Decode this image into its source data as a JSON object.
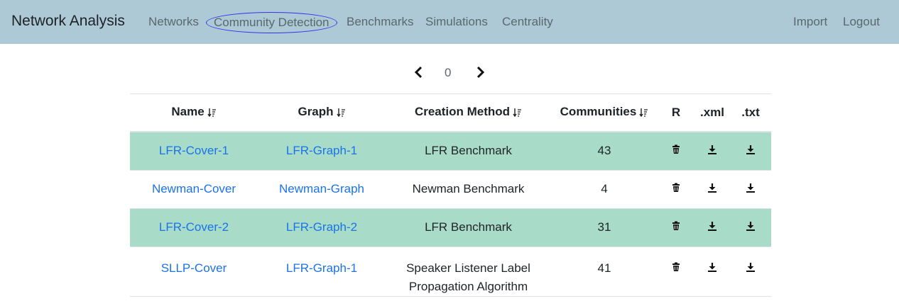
{
  "nav": {
    "brand": "Network Analysis",
    "links": [
      "Networks",
      "Community Detection",
      "Benchmarks",
      "Simulations",
      "Centrality"
    ],
    "right_links": [
      "Import",
      "Logout"
    ]
  },
  "pager": {
    "page": "0"
  },
  "table": {
    "headers": [
      "Name",
      "Graph",
      "Creation Method",
      "Communities",
      "R",
      ".xml",
      ".txt"
    ],
    "rows": [
      {
        "name": "LFR-Cover-1",
        "graph": "LFR-Graph-1",
        "method": "LFR Benchmark",
        "communities": "43"
      },
      {
        "name": "Newman-Cover",
        "graph": "Newman-Graph",
        "method": "Newman Benchmark",
        "communities": "4"
      },
      {
        "name": "LFR-Cover-2",
        "graph": "LFR-Graph-2",
        "method": "LFR Benchmark",
        "communities": "31"
      },
      {
        "name": "SLLP-Cover",
        "graph": "LFR-Graph-1",
        "method_line1": "Speaker Listener Label",
        "method_line2": "Propagation Algorithm",
        "communities": "41"
      }
    ]
  },
  "icons": {
    "sort": "sort-desc-icon",
    "delete": "trash-icon",
    "download": "download-icon",
    "prev": "chevron-left-icon",
    "next": "chevron-right-icon"
  },
  "colors": {
    "navbar": "#acc9d5",
    "highlight_row": "#a8dcc8",
    "link": "#1a73e8"
  }
}
